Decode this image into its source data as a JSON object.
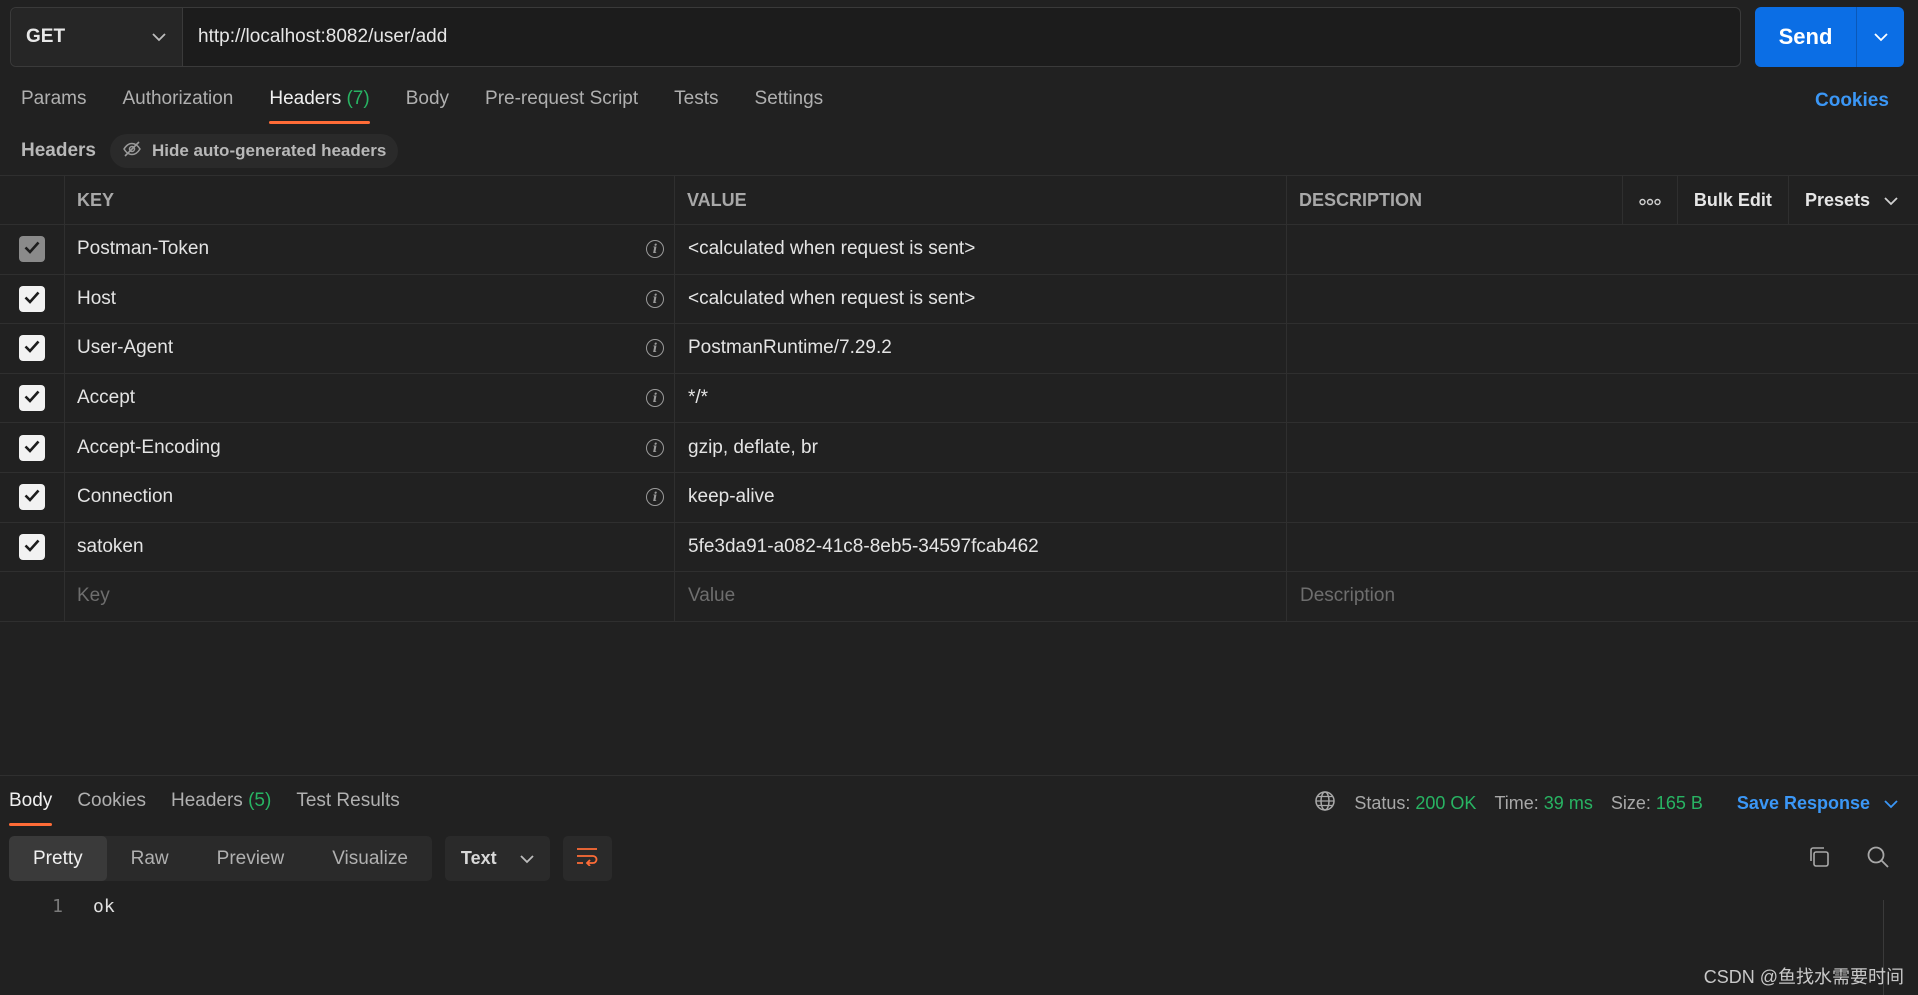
{
  "request": {
    "method": "GET",
    "url": "http://localhost:8082/user/add",
    "send_label": "Send"
  },
  "request_tabs": [
    {
      "label": "Params"
    },
    {
      "label": "Authorization"
    },
    {
      "label": "Headers",
      "count": "(7)"
    },
    {
      "label": "Body"
    },
    {
      "label": "Pre-request Script"
    },
    {
      "label": "Tests"
    },
    {
      "label": "Settings"
    }
  ],
  "cookies_label": "Cookies",
  "headers_section": {
    "title": "Headers",
    "hide_auto_label": "Hide auto-generated headers"
  },
  "table": {
    "columns": {
      "key": "KEY",
      "value": "VALUE",
      "description": "DESCRIPTION"
    },
    "bulk_edit_label": "Bulk Edit",
    "presets_label": "Presets",
    "rows": [
      {
        "key": "Postman-Token",
        "value": "<calculated when request is sent>",
        "checked": true,
        "disabled": true,
        "info": true
      },
      {
        "key": "Host",
        "value": "<calculated when request is sent>",
        "checked": true,
        "disabled": false,
        "info": true
      },
      {
        "key": "User-Agent",
        "value": "PostmanRuntime/7.29.2",
        "checked": true,
        "disabled": false,
        "info": true
      },
      {
        "key": "Accept",
        "value": "*/*",
        "checked": true,
        "disabled": false,
        "info": true
      },
      {
        "key": "Accept-Encoding",
        "value": "gzip, deflate, br",
        "checked": true,
        "disabled": false,
        "info": true
      },
      {
        "key": "Connection",
        "value": "keep-alive",
        "checked": true,
        "disabled": false,
        "info": true
      },
      {
        "key": "satoken",
        "value": "5fe3da91-a082-41c8-8eb5-34597fcab462",
        "checked": true,
        "disabled": false,
        "info": false
      }
    ],
    "new_row": {
      "key_placeholder": "Key",
      "value_placeholder": "Value",
      "description_placeholder": "Description"
    }
  },
  "response": {
    "tabs": [
      {
        "label": "Body"
      },
      {
        "label": "Cookies"
      },
      {
        "label": "Headers",
        "count": "(5)"
      },
      {
        "label": "Test Results"
      }
    ],
    "status_label": "Status:",
    "status_value": "200 OK",
    "time_label": "Time:",
    "time_value": "39 ms",
    "size_label": "Size:",
    "size_value": "165 B",
    "save_label": "Save Response",
    "view_modes": [
      "Pretty",
      "Raw",
      "Preview",
      "Visualize"
    ],
    "format": "Text",
    "body_lines": [
      {
        "n": "1",
        "text": "ok"
      }
    ]
  },
  "watermark": "CSDN @鱼找水需要时间",
  "colors": {
    "accent": "#ff6c37",
    "send": "#0b6ee5",
    "link": "#3b97f6",
    "success": "#28b463"
  }
}
